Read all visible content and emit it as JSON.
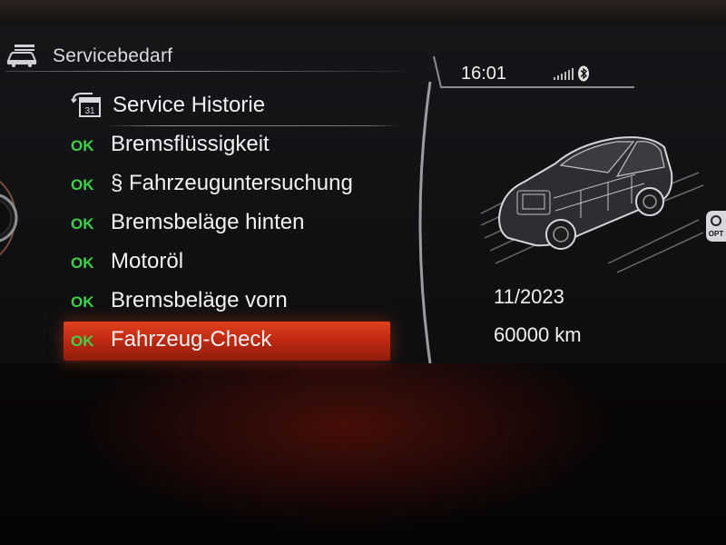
{
  "header": {
    "title": "Servicebedarf",
    "icon": "car-service-icon"
  },
  "status": {
    "time": "16:01",
    "signal_icon": "signal-strength-icon",
    "bluetooth_icon": "bluetooth-icon"
  },
  "menu": {
    "history": {
      "label": "Service Historie",
      "icon": "calendar-history-icon",
      "icon_text": "31"
    },
    "items": [
      {
        "status": "OK",
        "label": "Bremsflüssigkeit"
      },
      {
        "status": "OK",
        "label": "§ Fahrzeuguntersuchung"
      },
      {
        "status": "OK",
        "label": "Bremsbeläge hinten"
      },
      {
        "status": "OK",
        "label": "Motoröl"
      },
      {
        "status": "OK",
        "label": "Bremsbeläge vorn"
      },
      {
        "status": "OK",
        "label": "Fahrzeug-Check",
        "selected": true
      }
    ]
  },
  "detail": {
    "due_date": "11/2023",
    "due_distance": "60000 km",
    "image": "vehicle-xray-illustration"
  },
  "option_button": {
    "label": "OPT"
  },
  "colors": {
    "ok": "#3fd14a",
    "selection": "#d2381a",
    "text": "#f1f2f4"
  }
}
